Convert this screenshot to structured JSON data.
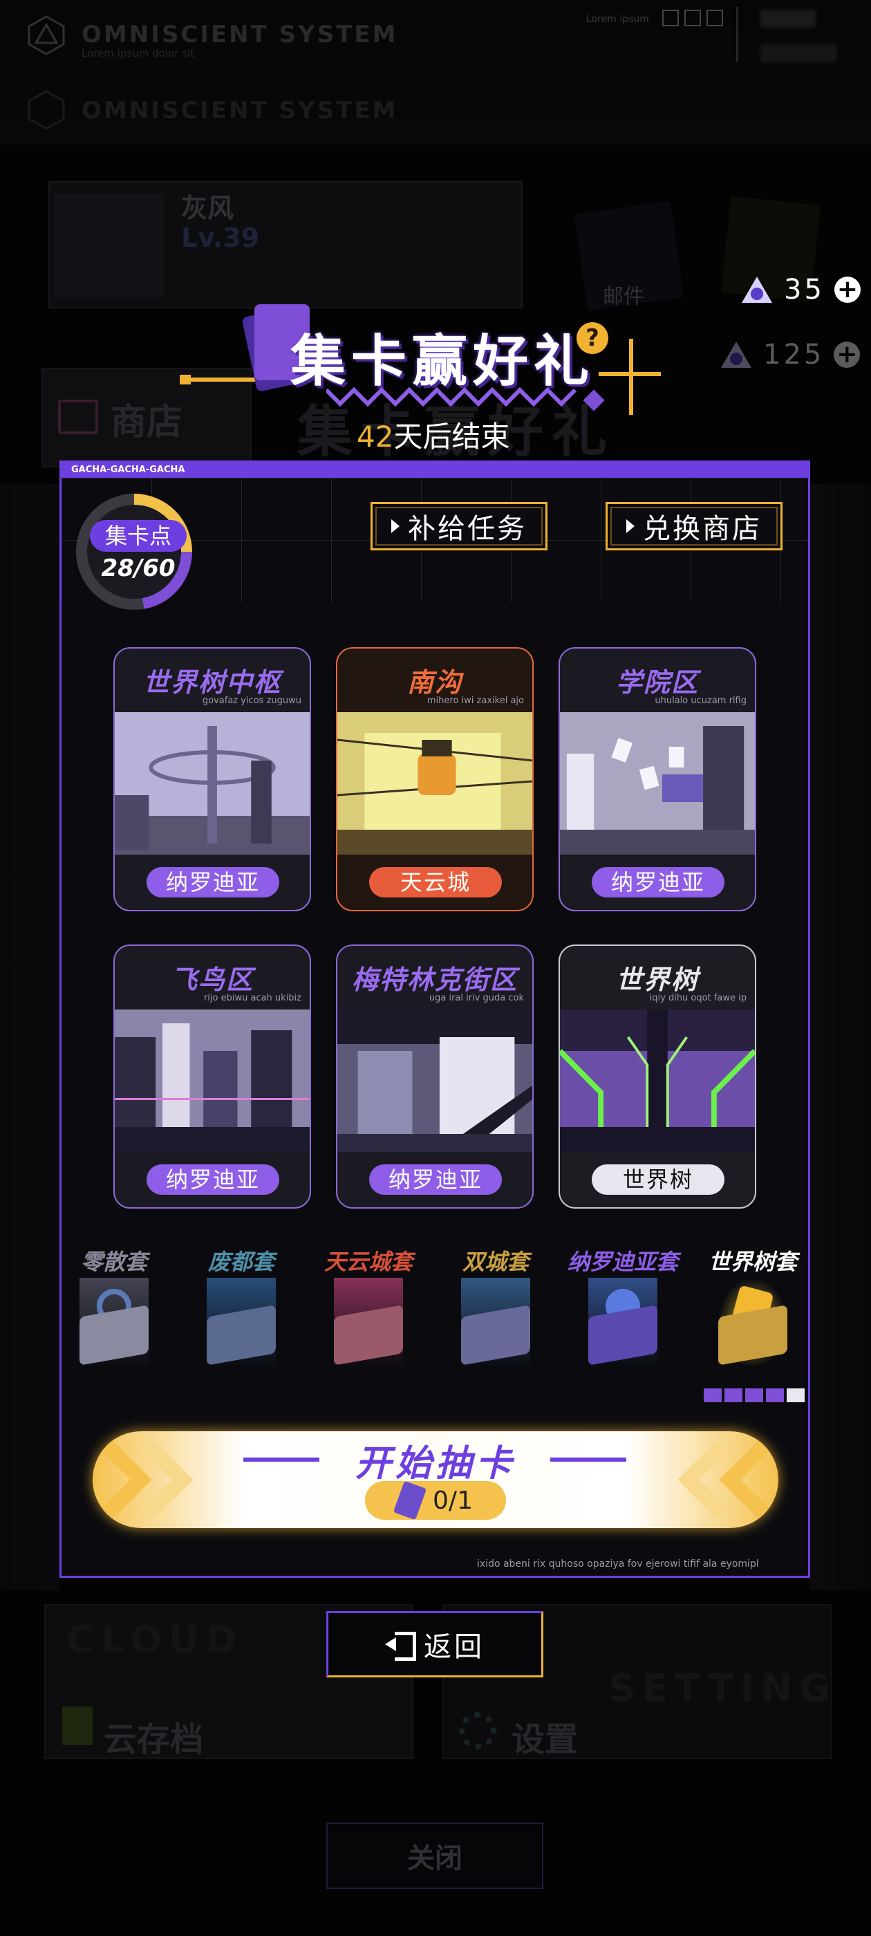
{
  "background": {
    "system_title": "OMNISCIENT SYSTEM",
    "system_subtitle": "Lorem ipsum dolor sit",
    "top_lorem": "Lorem ipsum",
    "profile_name": "灰风",
    "profile_level": "Lv.39",
    "mail_label": "邮件",
    "shop_label": "商店",
    "cloud_ghost": "CLOUD",
    "cloud_label": "云存档",
    "setting_ghost": "SETTING",
    "setting_label": "设置",
    "close_label": "关闭"
  },
  "currency": {
    "main_value": "35",
    "ghost_value": "125"
  },
  "banner": {
    "title": "集卡赢好礼",
    "help": "?",
    "days_number": "42",
    "days_suffix": "天后结束"
  },
  "panel": {
    "header": "GACHA-GACHA-GACHA",
    "points_label": "集卡点",
    "points_value": "28/60",
    "supply_button": "补给任务",
    "exchange_button": "兑换商店"
  },
  "cards": [
    {
      "title": "世界树中枢",
      "sub": "govafaz yicos zuguwu",
      "tag": "纳罗迪亚"
    },
    {
      "title": "南沟",
      "sub": "mihero iwi zaxikel ajo",
      "tag": "天云城"
    },
    {
      "title": "学院区",
      "sub": "uhulalo ucuzam rifig",
      "tag": "纳罗迪亚"
    },
    {
      "title": "飞鸟区",
      "sub": "rijo ebiwu acah ukibiz",
      "tag": "纳罗迪亚"
    },
    {
      "title": "梅特林克街区",
      "sub": "uga iral iriv guda cok",
      "tag": "纳罗迪亚"
    },
    {
      "title": "世界树",
      "sub": "iqiy dihu oqot fawe ip",
      "tag": "世界树"
    }
  ],
  "sets": [
    {
      "name": "零散套",
      "color": "#8a8a9a"
    },
    {
      "name": "废都套",
      "color": "#4f8fa8"
    },
    {
      "name": "天云城套",
      "color": "#d8503a"
    },
    {
      "name": "双城套",
      "color": "#c9a040"
    },
    {
      "name": "纳罗迪亚套",
      "color": "#8e5ee8"
    },
    {
      "name": "世界树套",
      "color": "#ffffff"
    }
  ],
  "draw": {
    "title": "开始抽卡",
    "tickets": "0/1",
    "footnote": "ixido abeni rix quhoso opaziya fov ejerowi tifif ala eyomipl"
  },
  "back_button": "返回",
  "colors": {
    "accent_purple": "#6e3fe0",
    "accent_gold": "#f0b230",
    "orange": "#e75c3a"
  }
}
